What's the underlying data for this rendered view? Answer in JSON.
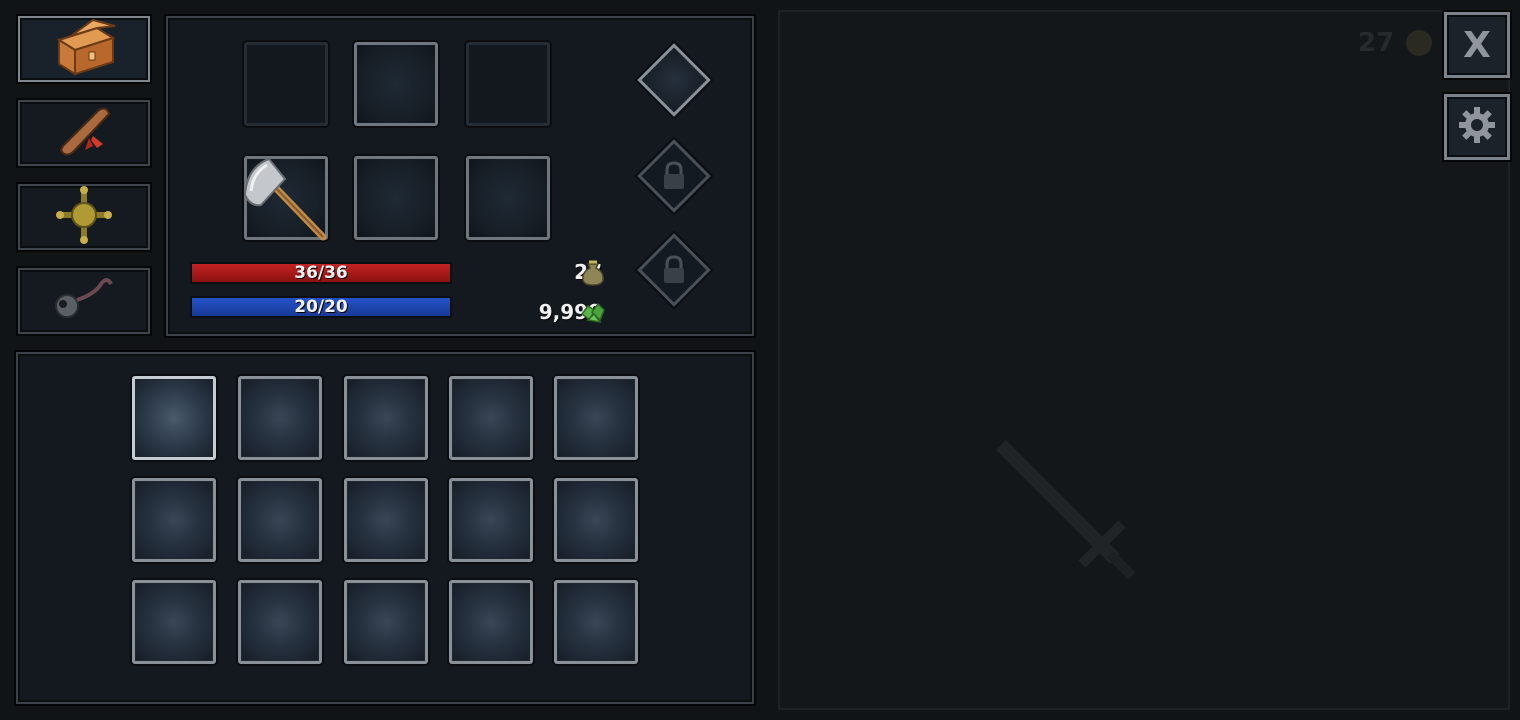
{
  "stats": {
    "hp_text": "36/36",
    "hp_fraction": 1.0,
    "mp_text": "20/20",
    "mp_fraction": 1.0,
    "bag_count": "27",
    "gems_count": "9,999"
  },
  "right_panel": {
    "faded_count": "27",
    "close_label": "X"
  },
  "tabs": [
    {
      "name": "chest-icon"
    },
    {
      "name": "scroll-icon"
    },
    {
      "name": "compass-icon"
    },
    {
      "name": "hook-icon"
    }
  ],
  "equipment": {
    "weapon_icon": "axe-icon"
  },
  "colors": {
    "hp_bar": "#c22424",
    "mp_bar": "#2552c8",
    "slot_border": "#8a9097",
    "background": "#111416"
  }
}
